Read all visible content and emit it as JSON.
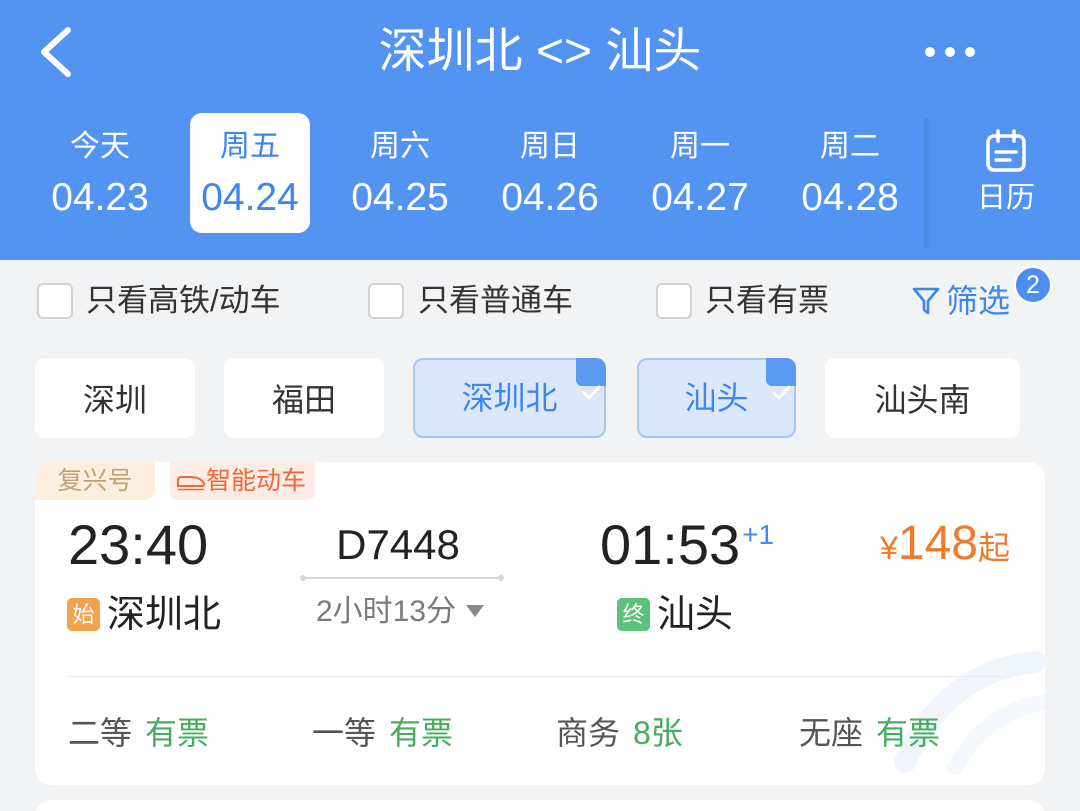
{
  "header": {
    "back_icon": "chevron-left-icon",
    "title": "深圳北 <> 汕头",
    "more_icon": "more-dots-icon",
    "dates": [
      {
        "day": "今天",
        "date": "04.23",
        "selected": false
      },
      {
        "day": "周五",
        "date": "04.24",
        "selected": true
      },
      {
        "day": "周六",
        "date": "04.25",
        "selected": false
      },
      {
        "day": "周日",
        "date": "04.26",
        "selected": false
      },
      {
        "day": "周一",
        "date": "04.27",
        "selected": false
      },
      {
        "day": "周二",
        "date": "04.28",
        "selected": false
      }
    ],
    "calendar": {
      "icon": "calendar-icon",
      "label": "日历"
    }
  },
  "filters": {
    "options": [
      {
        "label": "只看高铁/动车",
        "checked": false
      },
      {
        "label": "只看普通车",
        "checked": false
      },
      {
        "label": "只看有票",
        "checked": false
      }
    ],
    "filter_button": {
      "icon": "filter-icon",
      "label": "筛选",
      "badge": "2"
    }
  },
  "stations": [
    {
      "label": "深圳",
      "selected": false
    },
    {
      "label": "福田",
      "selected": false
    },
    {
      "label": "深圳北",
      "selected": true
    },
    {
      "label": "汕头",
      "selected": true
    },
    {
      "label": "汕头南",
      "selected": false
    }
  ],
  "trains": [
    {
      "tags": [
        {
          "label": "复兴号"
        },
        {
          "label": "智能动车",
          "icon": "bullet-train-icon"
        }
      ],
      "depart_time": "23:40",
      "train_no": "D7448",
      "duration": "2小时13分",
      "arrive_time": "01:53",
      "day_offset": "+1",
      "price_symbol": "¥",
      "price": "148",
      "price_suffix": "起",
      "from_badge": "始",
      "from_station": "深圳北",
      "to_badge": "终",
      "to_station": "汕头",
      "seats": [
        {
          "class": "二等",
          "availability": "有票"
        },
        {
          "class": "一等",
          "availability": "有票"
        },
        {
          "class": "商务",
          "availability": "8张"
        },
        {
          "class": "无座",
          "availability": "有票"
        }
      ]
    }
  ],
  "colors": {
    "header_bg": "#5393f1",
    "accent_blue": "#3b86ef",
    "price_orange": "#f07a2c",
    "available_green": "#46ad5c",
    "start_badge": "#f4a24d",
    "end_badge": "#5cc27b",
    "page_bg": "#f2f3f5"
  }
}
